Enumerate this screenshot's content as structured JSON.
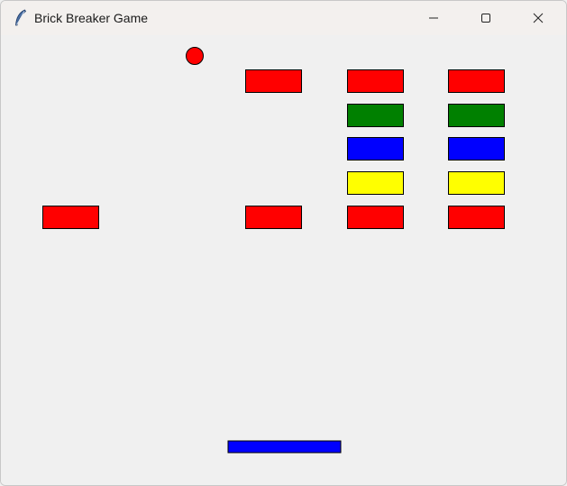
{
  "window": {
    "title": "Brick Breaker Game",
    "app_icon": "feather-icon",
    "controls": [
      "minimize-icon",
      "maximize-icon",
      "close-icon"
    ]
  },
  "game": {
    "colors": {
      "background": "#f0f0f0",
      "brick_outline": "#000000",
      "ball": "#ff0000",
      "paddle": "#0000ff"
    },
    "bricks": [
      {
        "col": 2,
        "row": 0,
        "color": "#ff0000"
      },
      {
        "col": 3,
        "row": 0,
        "color": "#ff0000"
      },
      {
        "col": 4,
        "row": 0,
        "color": "#ff0000"
      },
      {
        "col": 3,
        "row": 1,
        "color": "#008000"
      },
      {
        "col": 4,
        "row": 1,
        "color": "#008000"
      },
      {
        "col": 3,
        "row": 2,
        "color": "#0000ff"
      },
      {
        "col": 4,
        "row": 2,
        "color": "#0000ff"
      },
      {
        "col": 3,
        "row": 3,
        "color": "#ffff00"
      },
      {
        "col": 4,
        "row": 3,
        "color": "#ffff00"
      },
      {
        "col": 0,
        "row": 4,
        "color": "#ff0000"
      },
      {
        "col": 2,
        "row": 4,
        "color": "#ff0000"
      },
      {
        "col": 3,
        "row": 4,
        "color": "#ff0000"
      },
      {
        "col": 4,
        "row": 4,
        "color": "#ff0000"
      }
    ]
  }
}
